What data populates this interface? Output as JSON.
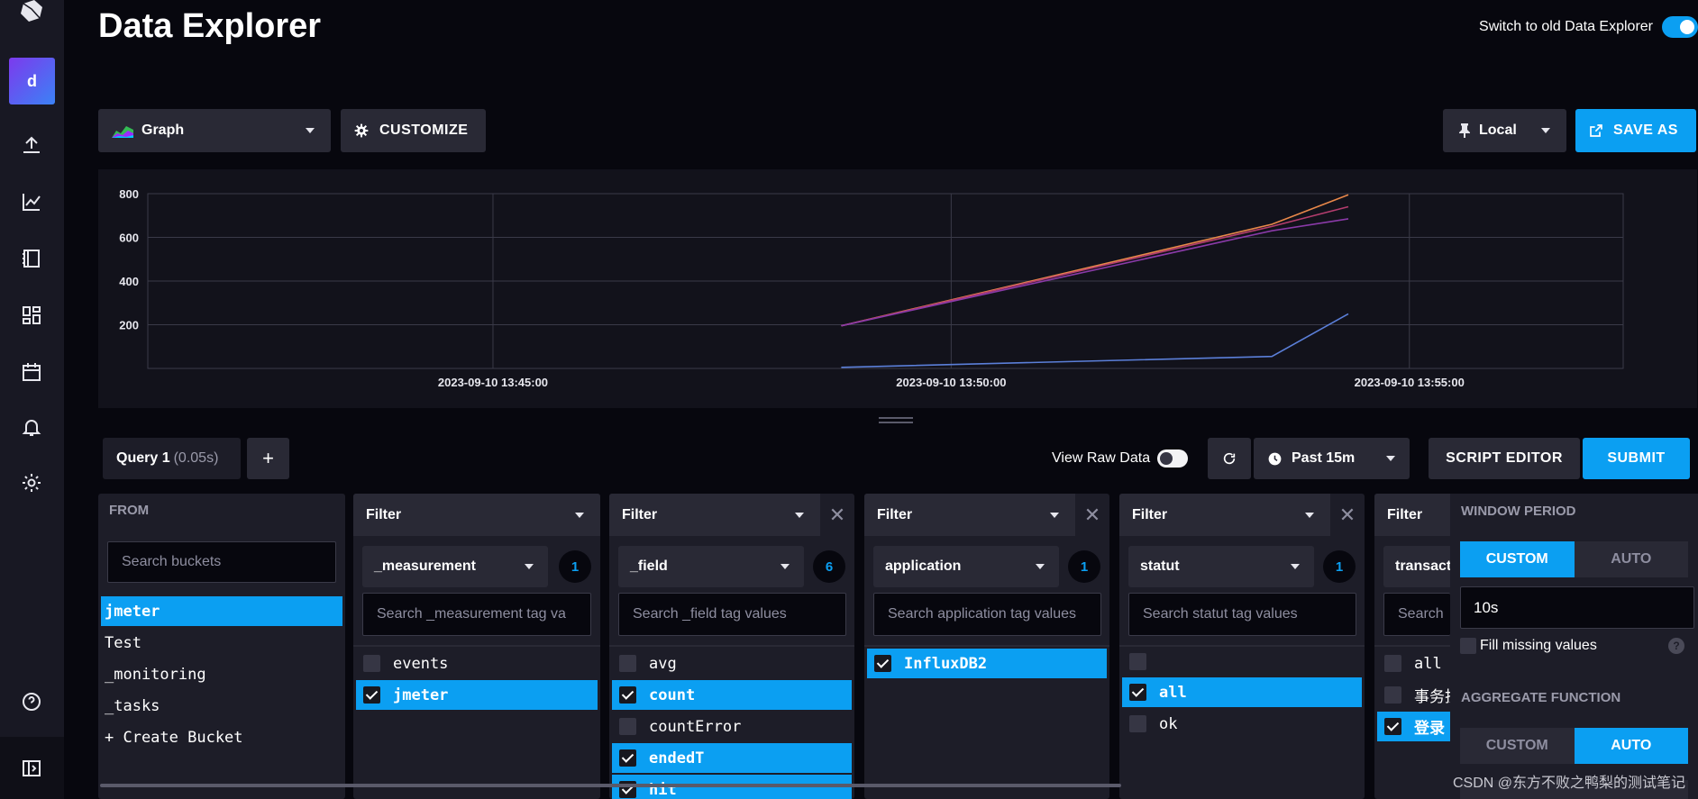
{
  "header": {
    "title": "Data Explorer",
    "switch_label": "Switch to old Data Explorer"
  },
  "nav": {
    "org_initial": "d",
    "icons": [
      "logo-icon",
      "upload-icon",
      "graph-icon",
      "notebook-icon",
      "dashboards-icon",
      "tasks-calendar-icon",
      "alerts-bell-icon",
      "settings-gear-icon",
      "help-icon",
      "collapse-sidebar-icon"
    ]
  },
  "toolbar": {
    "viz_type": "Graph",
    "customize_label": "CUSTOMIZE",
    "timezone": "Local",
    "save_as_label": "SAVE AS"
  },
  "chart_data": {
    "type": "line",
    "y_ticks": [
      200,
      400,
      600,
      800
    ],
    "ylim": [
      0,
      800
    ],
    "x_ticks": [
      "2023-09-10 13:45:00",
      "2023-09-10 13:50:00",
      "2023-09-10 13:55:00"
    ],
    "xlim": [
      "2023-09-10 13:41:14",
      "2023-09-10 13:57:20"
    ],
    "grid": true,
    "series": [
      {
        "color": "#e9884a",
        "points": [
          [
            "2023-09-10 13:48:48",
            195
          ],
          [
            "2023-09-10 13:53:30",
            660
          ],
          [
            "2023-09-10 13:54:20",
            795
          ]
        ]
      },
      {
        "color": "#b43d6e",
        "points": [
          [
            "2023-09-10 13:48:48",
            195
          ],
          [
            "2023-09-10 13:53:30",
            650
          ],
          [
            "2023-09-10 13:54:20",
            740
          ]
        ]
      },
      {
        "color": "#8a3aa8",
        "points": [
          [
            "2023-09-10 13:48:48",
            195
          ],
          [
            "2023-09-10 13:53:30",
            630
          ],
          [
            "2023-09-10 13:54:20",
            685
          ]
        ]
      },
      {
        "color": "#5b7fd9",
        "points": [
          [
            "2023-09-10 13:48:48",
            5
          ],
          [
            "2023-09-10 13:53:30",
            55
          ],
          [
            "2023-09-10 13:54:20",
            250
          ]
        ]
      }
    ]
  },
  "query": {
    "tab_label": "Query 1",
    "tab_time": "(0.05s)",
    "add_label": "+",
    "view_raw_label": "View Raw Data",
    "time_range": "Past 15m",
    "script_editor_label": "SCRIPT EDITOR",
    "submit_label": "SUBMIT"
  },
  "from_panel": {
    "title": "FROM",
    "search_placeholder": "Search buckets",
    "buckets": [
      "jmeter",
      "Test",
      "_monitoring",
      "_tasks",
      "+ Create Bucket"
    ],
    "selected": "jmeter"
  },
  "filters": [
    {
      "title": "Filter",
      "key": "_measurement",
      "count": "1",
      "search_placeholder": "Search _measurement tag va",
      "values": [
        {
          "label": "events",
          "checked": false
        },
        {
          "label": "jmeter",
          "checked": true
        }
      ]
    },
    {
      "title": "Filter",
      "key": "_field",
      "count": "6",
      "search_placeholder": "Search _field tag values",
      "values": [
        {
          "label": "avg",
          "checked": false
        },
        {
          "label": "count",
          "checked": true
        },
        {
          "label": "countError",
          "checked": false
        },
        {
          "label": "endedT",
          "checked": true
        },
        {
          "label": "hit",
          "checked": true
        }
      ]
    },
    {
      "title": "Filter",
      "key": "application",
      "count": "1",
      "search_placeholder": "Search application tag values",
      "values": [
        {
          "label": "InfluxDB2",
          "checked": true
        }
      ]
    },
    {
      "title": "Filter",
      "key": "statut",
      "count": "1",
      "search_placeholder": "Search statut tag values",
      "values": [
        {
          "label": "",
          "checked": false
        },
        {
          "label": "all",
          "checked": true
        },
        {
          "label": "ok",
          "checked": false
        }
      ]
    },
    {
      "title": "Filter",
      "key": "transact",
      "search_placeholder": "Search",
      "values": [
        {
          "label": "all",
          "checked": false
        },
        {
          "label": "事务技",
          "checked": false
        },
        {
          "label": "登录",
          "checked": true
        }
      ]
    }
  ],
  "aggregate": {
    "window_period_label": "WINDOW PERIOD",
    "custom_label": "CUSTOM",
    "auto_label": "AUTO",
    "period_value": "10s",
    "fill_missing_label": "Fill missing values",
    "help_mark": "?",
    "aggregate_function_label": "AGGREGATE FUNCTION"
  },
  "watermark": "CSDN @东方不败之鸭梨的测试笔记"
}
